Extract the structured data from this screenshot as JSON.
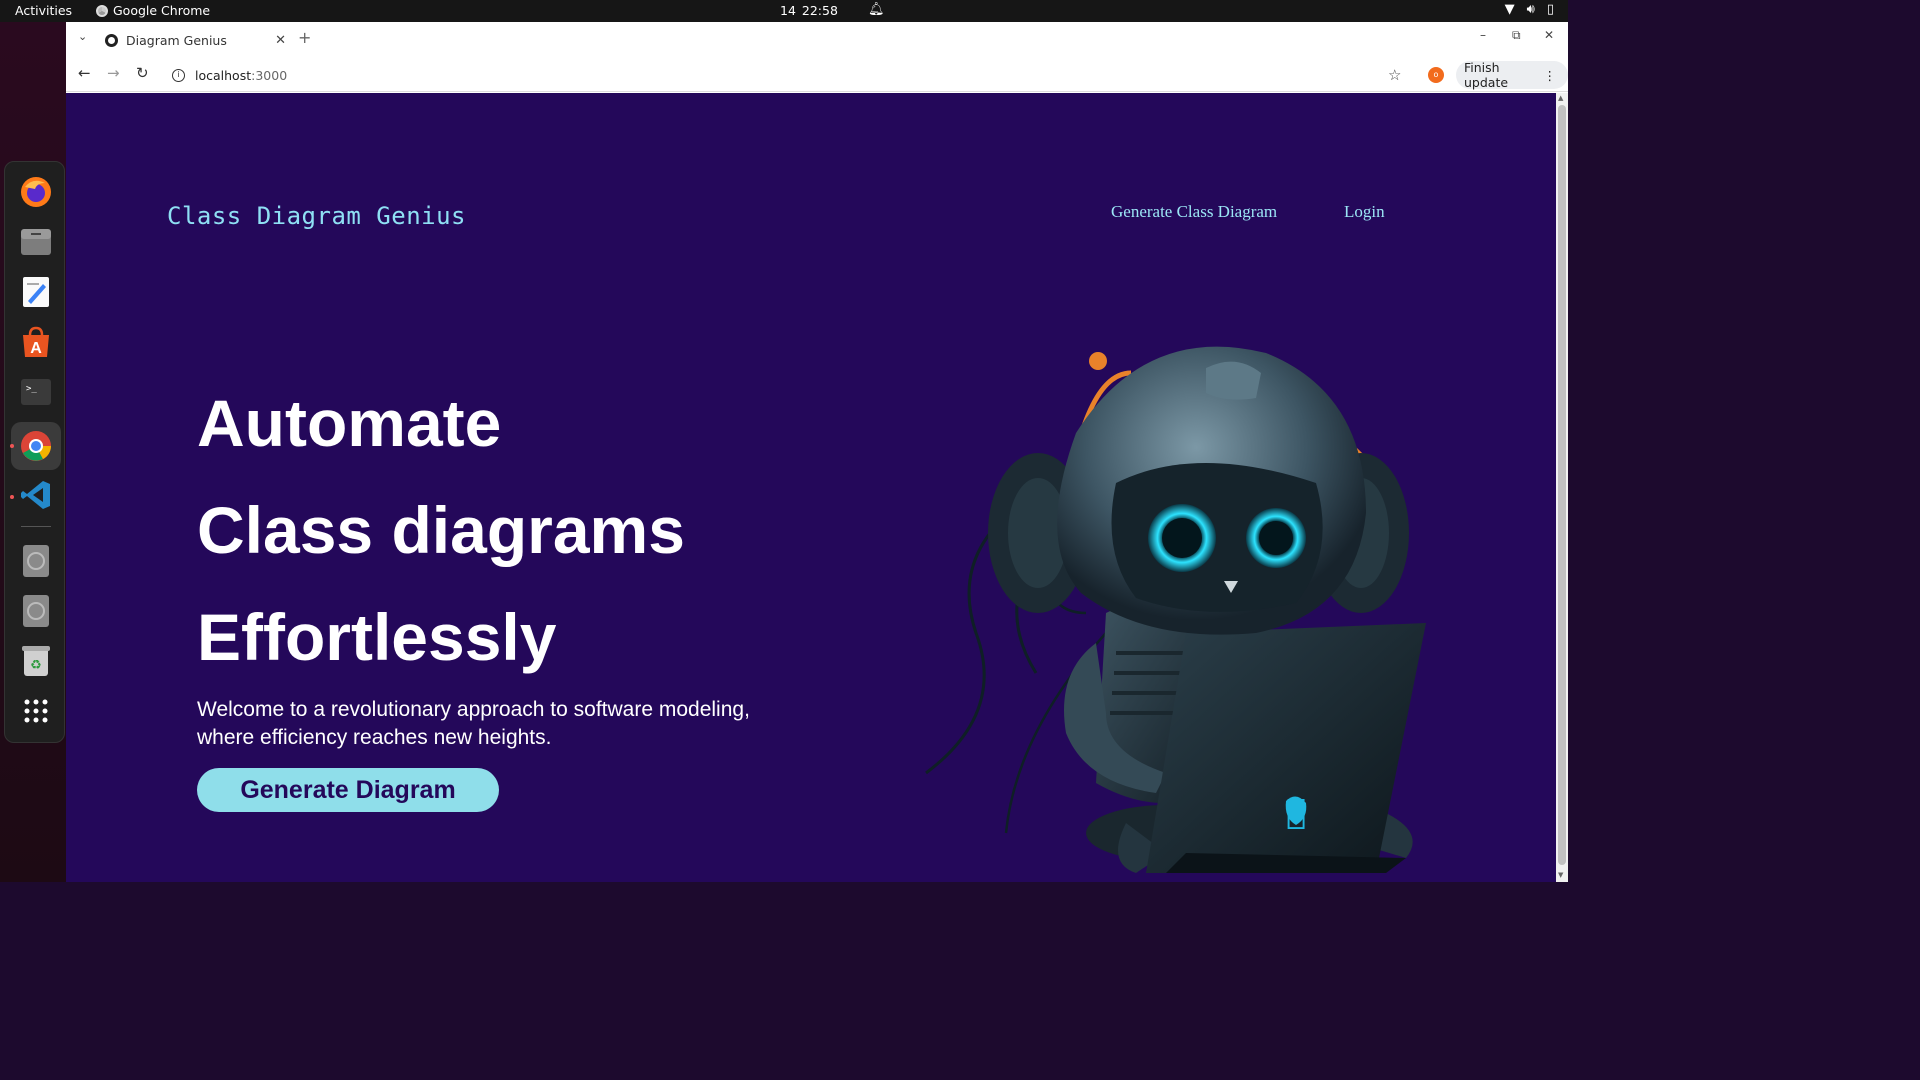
{
  "topbar": {
    "activities": "Activities",
    "app_name": "Google Chrome",
    "date": "14",
    "time": "22:58"
  },
  "dock": {
    "items": [
      "firefox-icon",
      "files-icon",
      "text-editor-icon",
      "app-center-icon",
      "terminal-icon",
      "chrome-icon",
      "vscode-icon",
      "disc-icon",
      "disc-icon",
      "trash-icon",
      "app-grid-icon"
    ]
  },
  "browser": {
    "tab_title": "Diagram Genius",
    "url_host": "localhost",
    "url_port": ":3000",
    "update_button": "Finish update",
    "extension_badge": "o"
  },
  "page": {
    "logo": "Class Diagram Genius",
    "nav": {
      "generate": "Generate Class Diagram",
      "login": "Login"
    },
    "hero": {
      "line1": "Automate",
      "line2": "Class diagrams",
      "line3": "Effortlessly",
      "subtitle": "Welcome to a revolutionary approach to software modeling, where efficiency reaches new heights.",
      "cta": "Generate Diagram"
    }
  },
  "colors": {
    "page_bg": "#24085a",
    "accent": "#8fdeea",
    "logo": "#8fe0f4"
  }
}
